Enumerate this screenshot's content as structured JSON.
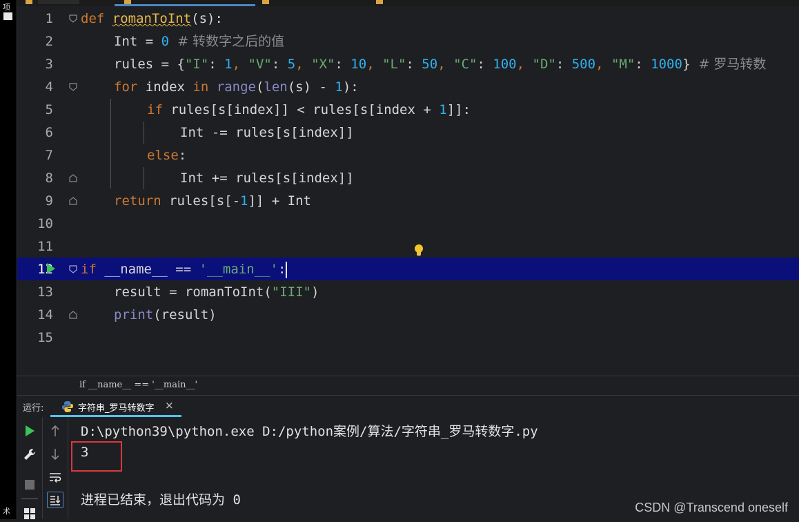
{
  "left_strip": {
    "top_glyph": "项",
    "bottom_glyph": "术"
  },
  "editor": {
    "line_numbers": [
      "1",
      "2",
      "3",
      "4",
      "5",
      "6",
      "7",
      "8",
      "9",
      "10",
      "11",
      "12",
      "13",
      "14",
      "15"
    ],
    "lines": {
      "l1": {
        "kw": "def",
        "name": "romanToInt",
        "rest": "(s):"
      },
      "l2": {
        "var": "Int",
        "op": " = ",
        "num": "0",
        "comment": "  # 转数字之后的值"
      },
      "l3": {
        "prefix": "rules = {",
        "k1": "\"I\"",
        "v1": "1",
        "k2": "\"V\"",
        "v2": "5",
        "k3": "\"X\"",
        "v3": "10",
        "k4": "\"L\"",
        "v4": "50",
        "k5": "\"C\"",
        "v5": "100",
        "k6": "\"D\"",
        "v6": "500",
        "k7": "\"M\"",
        "v7": "1000",
        "suffix": "}",
        "comment": "  # 罗马转数"
      },
      "l4": {
        "kw_for": "for",
        "mid": " index ",
        "kw_in": "in",
        "range": "range",
        "len": "len",
        "rest": "(s) - ",
        "num": "1",
        "end": "):"
      },
      "l5": {
        "kw": "if",
        "rest": " rules[s[index]] < rules[s[index + ",
        "num": "1",
        "end": "]]:"
      },
      "l6": {
        "code": "Int -= rules[s[index]]"
      },
      "l7": {
        "kw": "else",
        "end": ":"
      },
      "l8": {
        "code": "Int += rules[s[index]]"
      },
      "l9": {
        "kw": "return",
        "rest": " rules[s[-",
        "num": "1",
        "end": "]] + Int"
      },
      "l12": {
        "kw": "if",
        "rest": " __name__ == ",
        "str": "'__main__'",
        "end": ":"
      },
      "l13": {
        "rest": "result = romanToInt(",
        "str": "\"III\"",
        "end": ")"
      },
      "l14": {
        "fn": "print",
        "rest": "(result)"
      }
    }
  },
  "breadcrumb": "if __name__ == '__main__'",
  "run_panel": {
    "label": "运行:",
    "tab_label": "字符串_罗马转数字",
    "close_glyph": "×"
  },
  "console": {
    "command": "D:\\python39\\python.exe D:/python案例/算法/字符串_罗马转数字.py",
    "output": "3",
    "exit_message": "进程已结束，退出代码为 0"
  },
  "watermark": "CSDN @Transcend oneself",
  "colors": {
    "highlight_line": "#0a0f7a",
    "keyword": "#cc7832",
    "number": "#2fb1f0",
    "string": "#6aab73",
    "run_green": "#3ec25a",
    "result_box": "#d9393d"
  }
}
